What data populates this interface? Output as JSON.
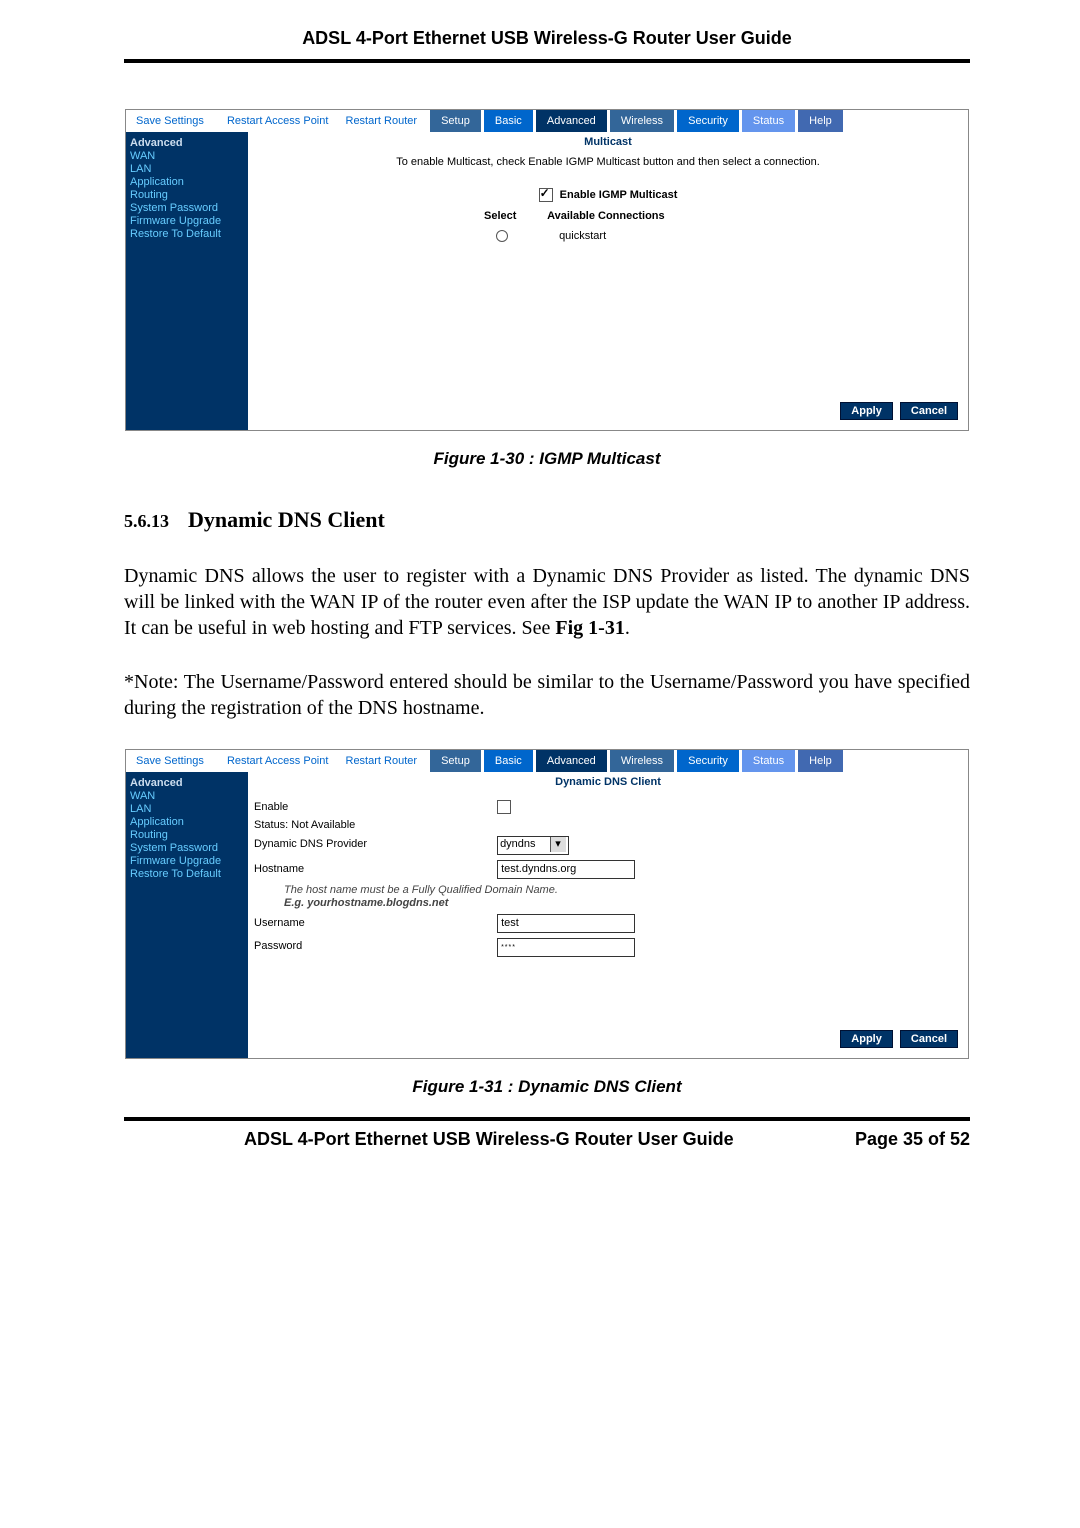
{
  "header": {
    "title": "ADSL 4-Port Ethernet USB Wireless-G Router User Guide"
  },
  "fig1": {
    "toolbar": {
      "save": "Save Settings",
      "rap": "Restart Access Point",
      "rr": "Restart Router"
    },
    "tabs": {
      "setup": "Setup",
      "basic": "Basic",
      "adv": "Advanced",
      "wrl": "Wireless",
      "sec": "Security",
      "stat": "Status",
      "help": "Help"
    },
    "sidebar": {
      "head": "Advanced",
      "items": [
        "WAN",
        "LAN",
        "Application",
        "Routing",
        "System Password",
        "Firmware Upgrade",
        "Restore To Default"
      ]
    },
    "pane": {
      "title": "Multicast",
      "intro": "To enable Multicast, check Enable IGMP Multicast button and then select a connection.",
      "enable": "Enable IGMP Multicast",
      "selectHdr": "Select",
      "availHdr": "Available Connections",
      "row0": "quickstart"
    },
    "buttons": {
      "apply": "Apply",
      "cancel": "Cancel"
    },
    "caption": "Figure 1-30 : IGMP Multicast"
  },
  "section": {
    "num": "5.6.13",
    "title": "Dynamic DNS Client"
  },
  "text": {
    "p1": "Dynamic DNS allows the user to register with a Dynamic DNS Provider as listed. The dynamic DNS will be linked with the WAN IP of the router even after the ISP update the WAN IP to another IP address. It can be useful in web hosting and FTP services. See ",
    "p1b": "Fig 1-31",
    "p1c": ".",
    "p2": "*Note: The Username/Password entered should be similar to the Username/Password you have specified during the registration of the DNS hostname."
  },
  "fig2": {
    "toolbar": {
      "save": "Save Settings",
      "rap": "Restart Access Point",
      "rr": "Restart Router"
    },
    "tabs": {
      "setup": "Setup",
      "basic": "Basic",
      "adv": "Advanced",
      "wrl": "Wireless",
      "sec": "Security",
      "stat": "Status",
      "help": "Help"
    },
    "sidebar": {
      "head": "Advanced",
      "items": [
        "WAN",
        "LAN",
        "Application",
        "Routing",
        "System Password",
        "Firmware Upgrade",
        "Restore To Default"
      ]
    },
    "pane": {
      "title": "Dynamic DNS Client",
      "enable": "Enable",
      "status": "Status: Not Available",
      "provider": "Dynamic DNS Provider",
      "providerValue": "dyndns",
      "hostname": "Hostname",
      "hostnameValue": "test.dyndns.org",
      "hint1": "The host name must be a Fully Qualified Domain Name.",
      "hint2": "E.g. yourhostname.blogdns.net",
      "user": "Username",
      "userValue": "test",
      "pass": "Password",
      "passValue": "****"
    },
    "buttons": {
      "apply": "Apply",
      "cancel": "Cancel"
    },
    "caption": "Figure 1-31 : Dynamic DNS Client"
  },
  "footer": {
    "left": "ADSL 4-Port Ethernet USB Wireless-G Router User Guide",
    "right": "Page 35 of 52"
  }
}
